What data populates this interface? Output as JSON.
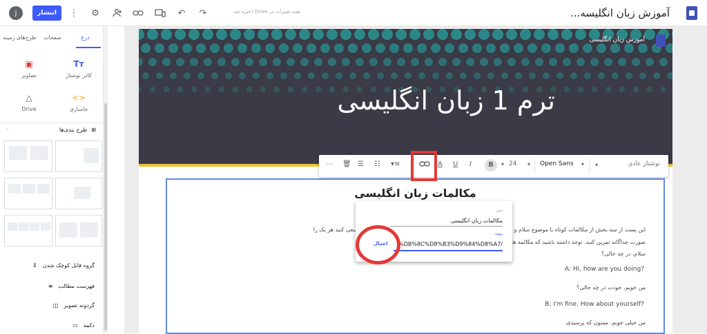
{
  "topbar": {
    "avatar_letter": "j",
    "publish_label": "انتشار",
    "saved_status": "همه تغییرات در Drive ذخیره شد",
    "site_title": "آموزش زبان انگلیسه..."
  },
  "sidebar": {
    "tabs": {
      "insert": "درج",
      "pages": "صفحات",
      "themes": "طرح‌های زمینه"
    },
    "items": {
      "text_box": "کادر نوشتار",
      "images": "تصاویر",
      "embed": "جاسازی",
      "drive": "Drive"
    },
    "layouts_title": "طرح بندی‌ها",
    "bottom": {
      "collapsible": "گروه قابل کوچک شدن",
      "toc": "فهرست مطالب",
      "carousel": "گردونه تصویر",
      "button": "دکمه"
    }
  },
  "page": {
    "site_name": "آموزش زبان انگلیسی",
    "hero_title": "ترم 1 زبان انگلیسی",
    "heading": "مکالمات زبان انگلیسی"
  },
  "toolbar": {
    "style": "نوشتار عادی",
    "font": "Open Sans",
    "size": "24"
  },
  "link_popup": {
    "text_label": "متن",
    "text_value": "مکالمات زبان انگلیسی",
    "link_label": "پیوند",
    "link_value": "%DB%8C%D8%B3%D9%84%D8%A7/",
    "apply": "اعمال"
  },
  "content": {
    "para1": "این پست از سه بخش از مکالمات کوتاه با موضوع سلام و ... ا در آنها از اصطلاحات و جملات متفاوت استفاده شده است.شما سعی کنید هر یک را",
    "para2": "صورت جداگانه تمرین کنید. توجه داشته باشید که مکالمه ها ... ی آن نوشته شده است.",
    "para3": "سلام، در چه حالی؟",
    "line1": "A: Hi, how are you doing?",
    "line2": "من خوبم، خودت در چه حالی؟",
    "line3": "B: I'm fine. How about yourself?",
    "line4": "من خیلی خوبم. ممنون که پرسیدی."
  }
}
